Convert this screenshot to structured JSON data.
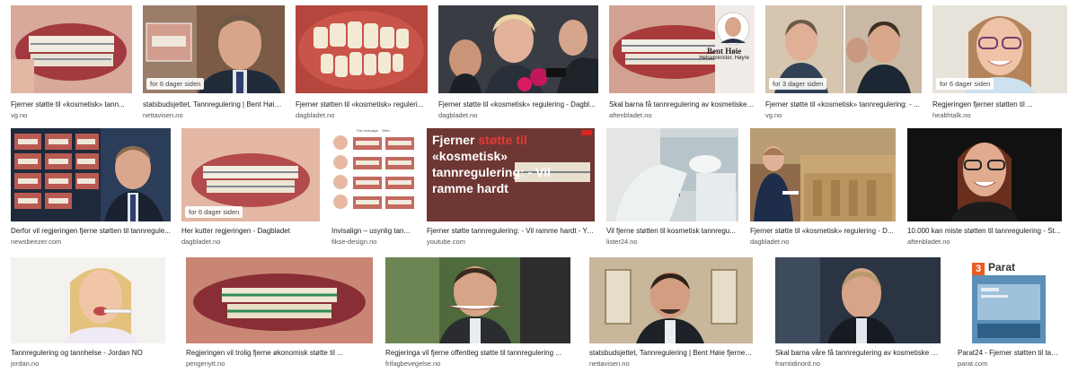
{
  "results": [
    {
      "caption": "Fjerner støtte til «kosmetisk» tann...",
      "source": "vg.no",
      "badge": "",
      "icon": "braces-photo"
    },
    {
      "caption": "statsbudsjettet, Tannregulering | Bent Høie ...",
      "source": "nettavisen.no",
      "badge": "for 6 dager siden",
      "icon": "politician-photo"
    },
    {
      "caption": "Fjerner støtten til «kosmetisk» reguleri...",
      "source": "dagbladet.no",
      "badge": "",
      "icon": "crooked-teeth-photo"
    },
    {
      "caption": "Fjerner støtte til «kosmetisk» regulering - Dagbl...",
      "source": "dagbladet.no",
      "badge": "",
      "icon": "press-photo"
    },
    {
      "caption": "Skal barna få tannregulering av kosmetiske ...",
      "source": "aftenbladet.no",
      "badge": "",
      "icon": "braces-photo"
    },
    {
      "caption": "Fjerner støtte til «kosmetisk» tannregulering: - ...",
      "source": "vg.no",
      "badge": "for 3 dager siden",
      "icon": "politicians-photo"
    },
    {
      "caption": "Regjeringen fjerner støtten til ...",
      "source": "healthtalk.no",
      "badge": "for 6 dager siden",
      "icon": "girl-glasses-photo"
    },
    {
      "caption": "Derfor vil regjeringen fjerne støtten til tannregule...",
      "source": "newsbeezer.com",
      "badge": "",
      "icon": "collage-photo"
    },
    {
      "caption": "Her kutter regjeringen - Dagbladet",
      "source": "dagbladet.no",
      "badge": "for 6 dager siden",
      "icon": "braces-photo"
    },
    {
      "caption": "Invisalign – usynlig tan...",
      "source": "fikse-design.no",
      "badge": "",
      "icon": "before-after-grid"
    },
    {
      "caption": "Fjerner støtte tannregulering: - Vil ramme hardt - Yo...",
      "source": "youtube.com",
      "badge": "",
      "icon": "video-thumbnail"
    },
    {
      "caption": "Vil fjerne støtten til kosmetisk tannregu...",
      "source": "lister24.no",
      "badge": "",
      "icon": "dental-clinic-photo"
    },
    {
      "caption": "Fjerner støtte til «kosmetisk» regulering - D...",
      "source": "dagbladet.no",
      "badge": "",
      "icon": "parliament-photo"
    },
    {
      "caption": "10.000 kan miste støtten til tannregulering - St...",
      "source": "aftenbladet.no",
      "badge": "",
      "icon": "woman-glasses-photo"
    },
    {
      "caption": "Tannregulering og tannhelse - Jordan NO",
      "source": "jordan.no",
      "badge": "",
      "icon": "toothbrush-girl-photo"
    },
    {
      "caption": "Regjeringen vil trolig fjerne økonomisk støtte til ...",
      "source": "pengenytt.no",
      "badge": "",
      "icon": "braces-photo"
    },
    {
      "caption": "Regjeringa vil fjerne offentleg støtte til tannregulering ...",
      "source": "frifagbevegelse.no",
      "badge": "",
      "icon": "politician-photo"
    },
    {
      "caption": "statsbudsjettet, Tannregulering | Bent Høie fjerner st...",
      "source": "nettavisen.no",
      "badge": "",
      "icon": "politician-photo"
    },
    {
      "caption": "Skal barna våre få tannregulering av kosmetiske gru...",
      "source": "framtidinord.no",
      "badge": "",
      "icon": "politician-photo"
    },
    {
      "caption": "Parat24 - Fjerner støtten til tann...",
      "source": "parat.com",
      "badge": "",
      "icon": "magazine-cover"
    }
  ],
  "overlays": {
    "hoie_name": "Bent Høie",
    "hoie_role": "Helseminister, Høyre",
    "yt_title_1": "Fjerner",
    "yt_title_red": "støtte til",
    "yt_title_2": "«kosmetisk»",
    "yt_title_3": "tannregulering: - Vil",
    "yt_title_4": "ramme hardt",
    "parat_num": "3",
    "parat_name": "Parat",
    "fiske_col1": "Før Invisalign",
    "fiske_col2": "Etter"
  },
  "colors": {
    "accent_red": "#e53935",
    "parat_orange": "#e85d22"
  }
}
